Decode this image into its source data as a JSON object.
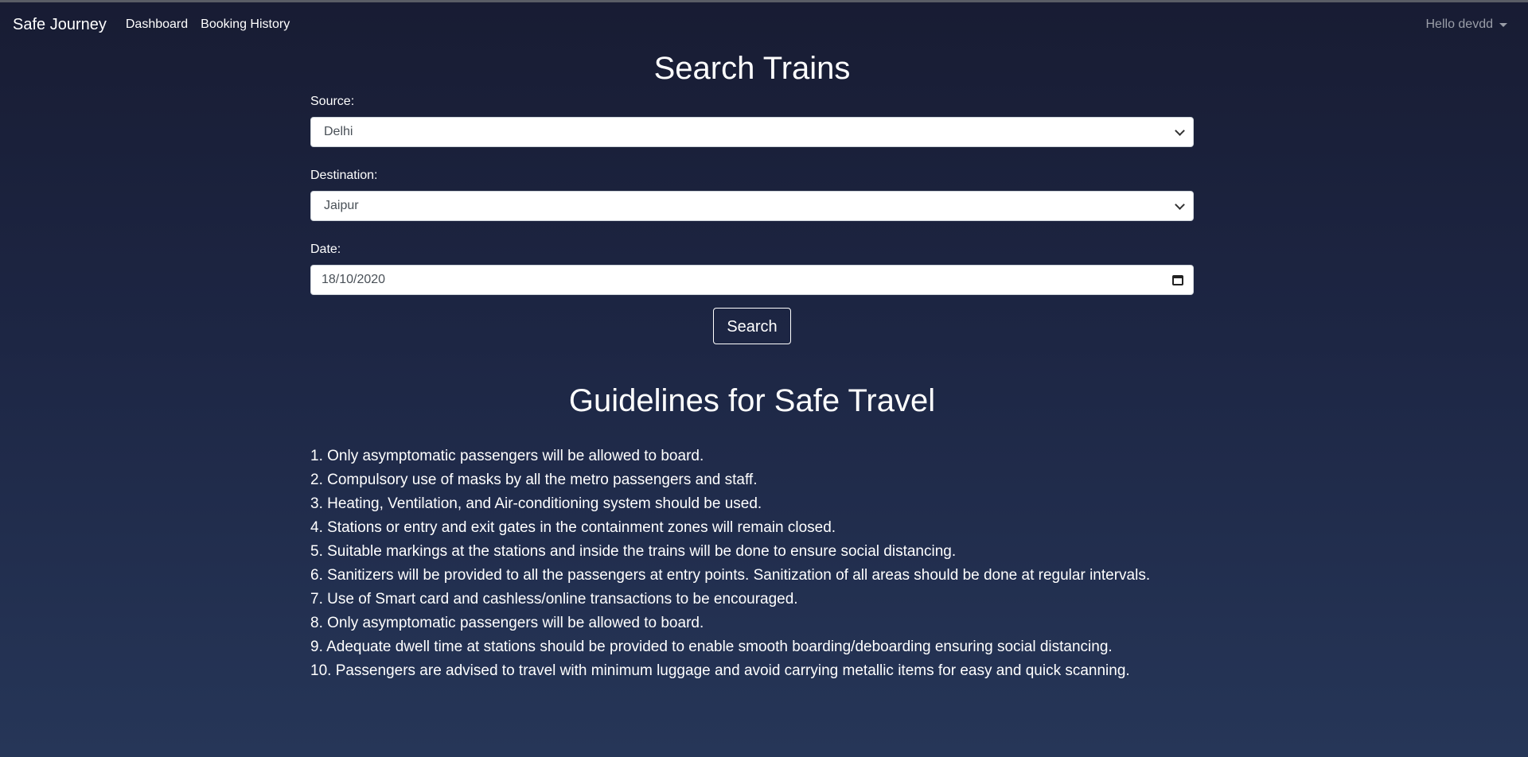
{
  "nav": {
    "brand": "Safe Journey",
    "links": [
      "Dashboard",
      "Booking History"
    ],
    "user": "Hello devdd"
  },
  "search": {
    "title": "Search Trains",
    "source_label": "Source:",
    "source_value": "Delhi",
    "destination_label": "Destination:",
    "destination_value": "Jaipur",
    "date_label": "Date:",
    "date_value": "18/10/2020",
    "button": "Search"
  },
  "guidelines": {
    "title": "Guidelines for Safe Travel",
    "items": [
      "1. Only asymptomatic passengers will be allowed to board.",
      "2. Compulsory use of masks by all the metro passengers and staff.",
      "3. Heating, Ventilation, and Air-conditioning system should be used.",
      "4. Stations or entry and exit gates in the containment zones will remain closed.",
      "5. Suitable markings at the stations and inside the trains will be done to ensure social distancing.",
      "6. Sanitizers will be provided to all the passengers at entry points. Sanitization of all areas should be done at regular intervals.",
      "7. Use of Smart card and cashless/online transactions to be encouraged.",
      "8. Only asymptomatic passengers will be allowed to board.",
      "9. Adequate dwell time at stations should be provided to enable smooth boarding/deboarding ensuring social distancing.",
      "10. Passengers are advised to travel with minimum luggage and avoid carrying metallic items for easy and quick scanning."
    ]
  },
  "icons": {
    "select_arrow": "chevron-down-icon",
    "date_picker": "calendar-icon",
    "user_dropdown": "caret-down-icon"
  },
  "colors": {
    "background_top": "#181c33",
    "background_bottom": "#263658",
    "text": "#ffffff",
    "muted": "#9a9ea8"
  }
}
